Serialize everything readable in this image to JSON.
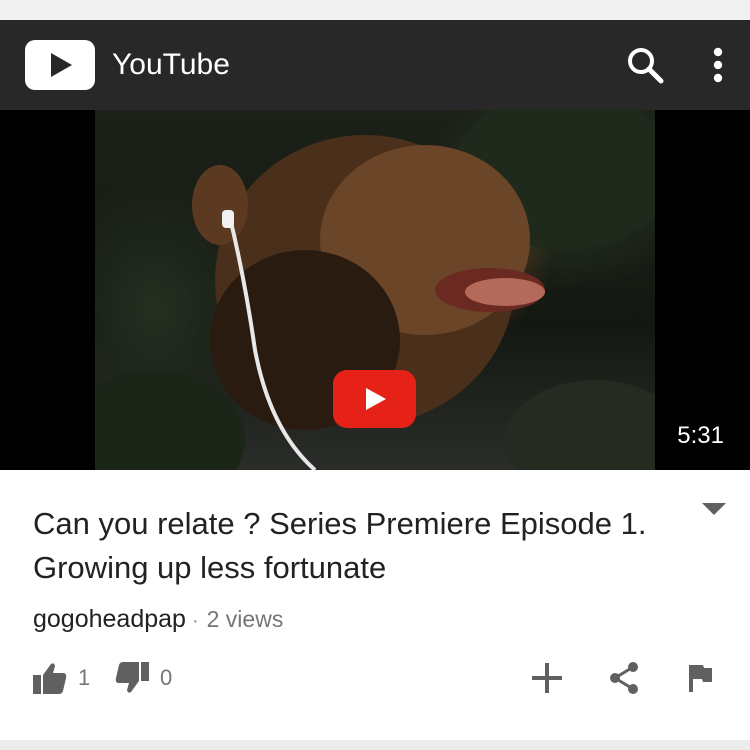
{
  "appbar": {
    "logo_icon": "youtube-play-logo-icon",
    "title": "YouTube",
    "search_icon": "search-icon",
    "more_icon": "more-vert-icon",
    "background": "#282828"
  },
  "player": {
    "thumbnail": "video-thumbnail",
    "play_icon": "play-icon",
    "duration": "5:31",
    "accent": "#e62117"
  },
  "video": {
    "title": "Can you relate ? Series Premiere Episode 1. Growing up less fortunate",
    "channel": "gogoheadpap",
    "separator": "·",
    "views": "2 views",
    "expand_icon": "expand-more-icon"
  },
  "actions": {
    "like_icon": "thumbs-up-icon",
    "like_count": "1",
    "dislike_icon": "thumbs-down-icon",
    "dislike_count": "0",
    "add_icon": "add-icon",
    "share_icon": "share-icon",
    "flag_icon": "flag-icon"
  }
}
